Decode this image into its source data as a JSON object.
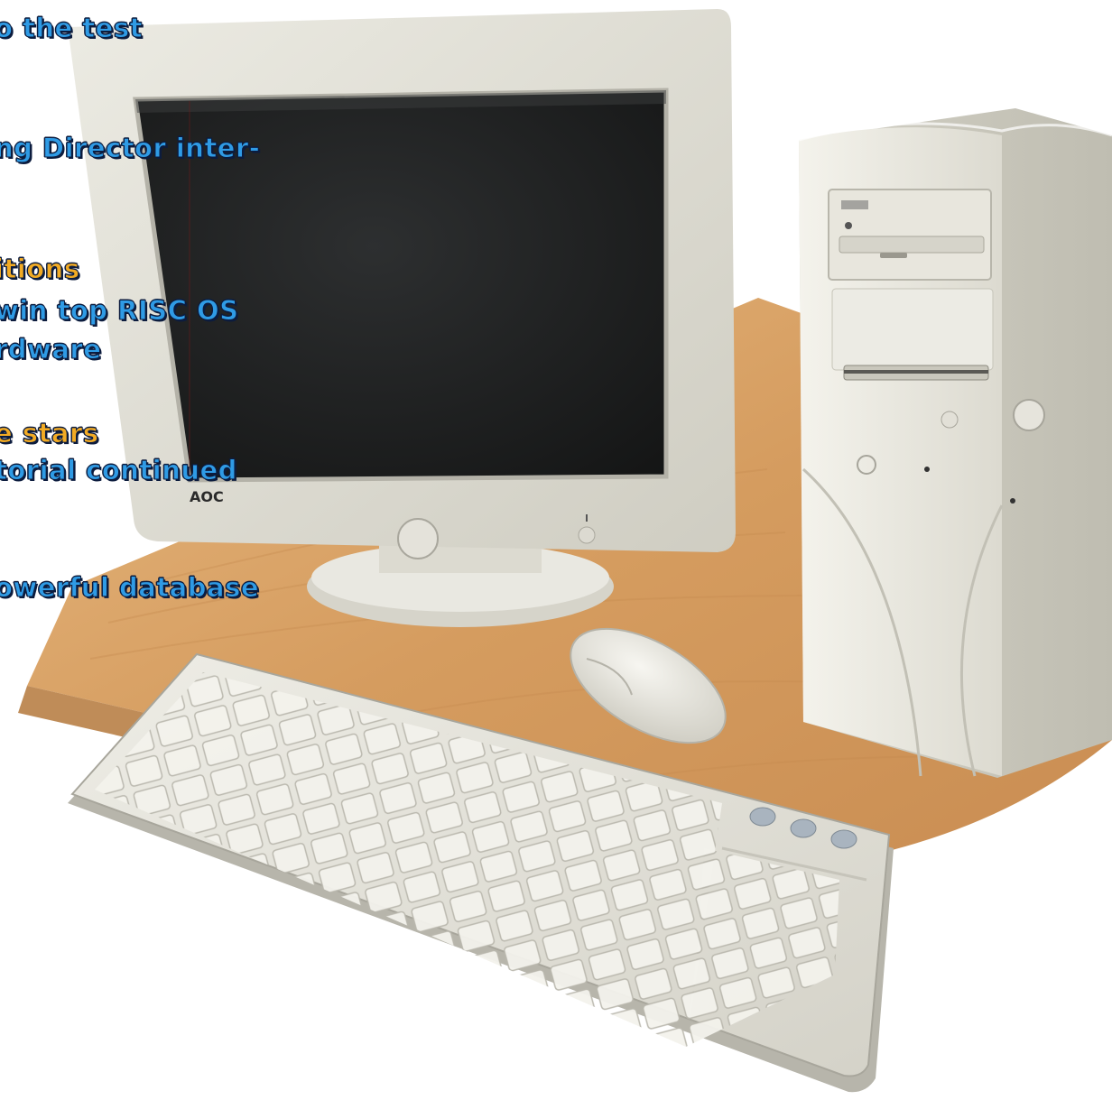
{
  "cover_lines": [
    {
      "id": "l1",
      "text": "o the test",
      "color": "blue"
    },
    {
      "id": "l2",
      "text": "ng Director inter-",
      "color": "blue"
    },
    {
      "id": "l3",
      "text": "itions",
      "color": "amber"
    },
    {
      "id": "l4",
      "text": "win top RISC OS",
      "color": "blue"
    },
    {
      "id": "l5",
      "text": "rdware",
      "color": "blue"
    },
    {
      "id": "l6",
      "text": "e stars",
      "color": "amber"
    },
    {
      "id": "l7",
      "text": "torial continued",
      "color": "blue"
    },
    {
      "id": "l8",
      "text": "owerful database",
      "color": "blue"
    }
  ],
  "monitor_brand": "AOC",
  "colors": {
    "blue_text": "#2f9be5",
    "amber_text": "#f2ab24",
    "desk_wood": "#d9a46a",
    "beige_plastic": "#e8e7df"
  }
}
